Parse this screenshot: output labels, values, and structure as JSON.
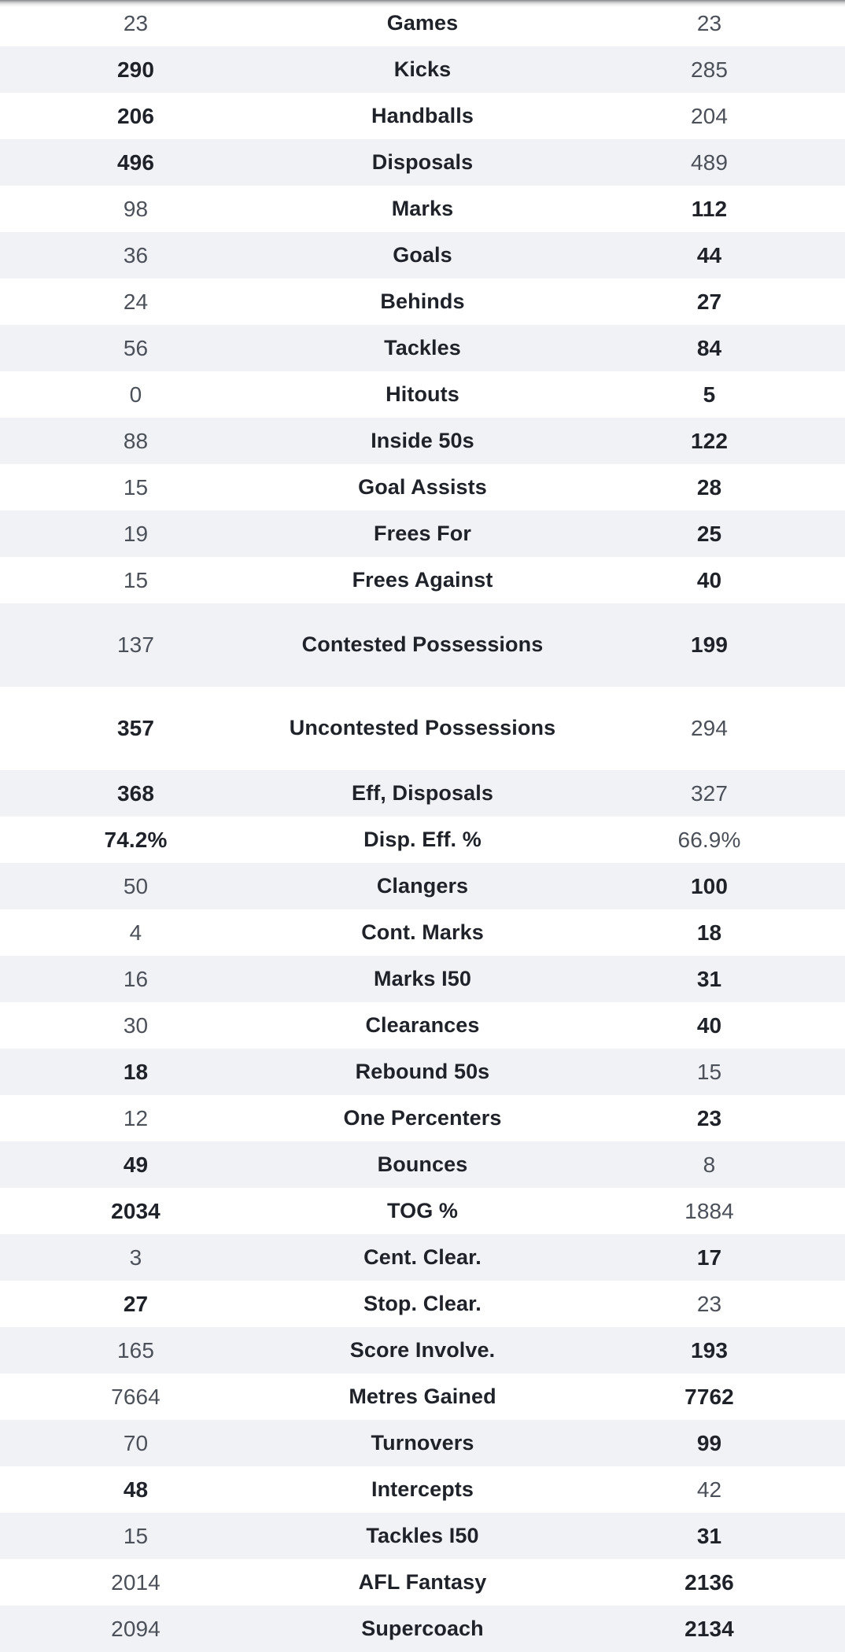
{
  "table": {
    "columns": [
      "left",
      "stat",
      "right"
    ],
    "rows": [
      {
        "left": "23",
        "stat": "Games",
        "right": "23",
        "lead": "none"
      },
      {
        "left": "290",
        "stat": "Kicks",
        "right": "285",
        "lead": "left"
      },
      {
        "left": "206",
        "stat": "Handballs",
        "right": "204",
        "lead": "left"
      },
      {
        "left": "496",
        "stat": "Disposals",
        "right": "489",
        "lead": "left"
      },
      {
        "left": "98",
        "stat": "Marks",
        "right": "112",
        "lead": "right"
      },
      {
        "left": "36",
        "stat": "Goals",
        "right": "44",
        "lead": "right"
      },
      {
        "left": "24",
        "stat": "Behinds",
        "right": "27",
        "lead": "right"
      },
      {
        "left": "56",
        "stat": "Tackles",
        "right": "84",
        "lead": "right"
      },
      {
        "left": "0",
        "stat": "Hitouts",
        "right": "5",
        "lead": "right"
      },
      {
        "left": "88",
        "stat": "Inside 50s",
        "right": "122",
        "lead": "right"
      },
      {
        "left": "15",
        "stat": "Goal Assists",
        "right": "28",
        "lead": "right"
      },
      {
        "left": "19",
        "stat": "Frees For",
        "right": "25",
        "lead": "right"
      },
      {
        "left": "15",
        "stat": "Frees Against",
        "right": "40",
        "lead": "right"
      },
      {
        "left": "137",
        "stat": "Contested Possessions",
        "right": "199",
        "lead": "right",
        "tall": true
      },
      {
        "left": "357",
        "stat": "Uncontested Possessions",
        "right": "294",
        "lead": "left",
        "tall": true
      },
      {
        "left": "368",
        "stat": "Eff, Disposals",
        "right": "327",
        "lead": "left"
      },
      {
        "left": "74.2%",
        "stat": "Disp. Eff. %",
        "right": "66.9%",
        "lead": "left"
      },
      {
        "left": "50",
        "stat": "Clangers",
        "right": "100",
        "lead": "right"
      },
      {
        "left": "4",
        "stat": "Cont. Marks",
        "right": "18",
        "lead": "right"
      },
      {
        "left": "16",
        "stat": "Marks I50",
        "right": "31",
        "lead": "right"
      },
      {
        "left": "30",
        "stat": "Clearances",
        "right": "40",
        "lead": "right"
      },
      {
        "left": "18",
        "stat": "Rebound 50s",
        "right": "15",
        "lead": "left"
      },
      {
        "left": "12",
        "stat": "One Percenters",
        "right": "23",
        "lead": "right"
      },
      {
        "left": "49",
        "stat": "Bounces",
        "right": "8",
        "lead": "left"
      },
      {
        "left": "2034",
        "stat": "TOG %",
        "right": "1884",
        "lead": "left"
      },
      {
        "left": "3",
        "stat": "Cent. Clear.",
        "right": "17",
        "lead": "right"
      },
      {
        "left": "27",
        "stat": "Stop. Clear.",
        "right": "23",
        "lead": "left"
      },
      {
        "left": "165",
        "stat": "Score Involve.",
        "right": "193",
        "lead": "right"
      },
      {
        "left": "7664",
        "stat": "Metres Gained",
        "right": "7762",
        "lead": "right"
      },
      {
        "left": "70",
        "stat": "Turnovers",
        "right": "99",
        "lead": "right"
      },
      {
        "left": "48",
        "stat": "Intercepts",
        "right": "42",
        "lead": "left"
      },
      {
        "left": "15",
        "stat": "Tackles I50",
        "right": "31",
        "lead": "right"
      },
      {
        "left": "2014",
        "stat": "AFL Fantasy",
        "right": "2136",
        "lead": "right"
      },
      {
        "left": "2094",
        "stat": "Supercoach",
        "right": "2134",
        "lead": "right"
      }
    ]
  },
  "colors": {
    "row_background": "#ffffff",
    "row_background_alt": "#f1f2f6",
    "text_strong": "#1f2329",
    "text_muted": "#4b5059"
  }
}
